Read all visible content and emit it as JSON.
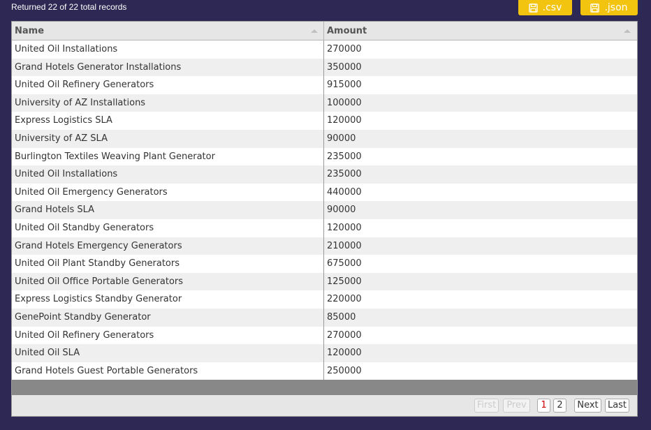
{
  "status_text": "Returned 22 of 22 total records",
  "export": {
    "csv_label": ".csv",
    "json_label": ".json",
    "icon": "save-icon",
    "color": "#f2c30f"
  },
  "columns": [
    {
      "label": "Name",
      "sort": "ascending-indicator"
    },
    {
      "label": "Amount",
      "sort": "ascending-indicator"
    }
  ],
  "rows": [
    {
      "name": "United Oil Installations",
      "amount": "270000"
    },
    {
      "name": "Grand Hotels Generator Installations",
      "amount": "350000"
    },
    {
      "name": "United Oil Refinery Generators",
      "amount": "915000"
    },
    {
      "name": "University of AZ Installations",
      "amount": "100000"
    },
    {
      "name": "Express Logistics SLA",
      "amount": "120000"
    },
    {
      "name": "University of AZ SLA",
      "amount": "90000"
    },
    {
      "name": "Burlington Textiles Weaving Plant Generator",
      "amount": "235000"
    },
    {
      "name": "United Oil Installations",
      "amount": "235000"
    },
    {
      "name": "United Oil Emergency Generators",
      "amount": "440000"
    },
    {
      "name": "Grand Hotels SLA",
      "amount": "90000"
    },
    {
      "name": "United Oil Standby Generators",
      "amount": "120000"
    },
    {
      "name": "Grand Hotels Emergency Generators",
      "amount": "210000"
    },
    {
      "name": "United Oil Plant Standby Generators",
      "amount": "675000"
    },
    {
      "name": "United Oil Office Portable Generators",
      "amount": "125000"
    },
    {
      "name": "Express Logistics Standby Generator",
      "amount": "220000"
    },
    {
      "name": "GenePoint Standby Generator",
      "amount": "85000"
    },
    {
      "name": "United Oil Refinery Generators",
      "amount": "270000"
    },
    {
      "name": "United Oil SLA",
      "amount": "120000"
    },
    {
      "name": "Grand Hotels Guest Portable Generators",
      "amount": "250000"
    }
  ],
  "pagination": {
    "first": "First",
    "prev": "Prev",
    "pages": [
      "1",
      "2"
    ],
    "current_page": "1",
    "next": "Next",
    "last": "Last"
  },
  "colors": {
    "background": "#2d2954",
    "active_page": "#d00000"
  }
}
